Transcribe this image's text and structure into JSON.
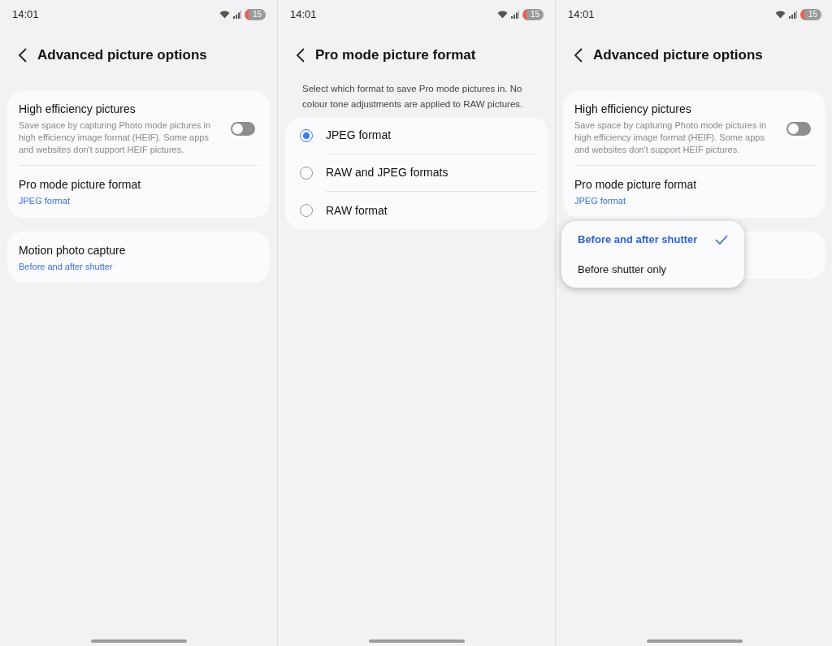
{
  "screens": [
    {
      "status": {
        "time": "14:01",
        "battery": "15"
      },
      "title": "Advanced picture options",
      "cards": [
        {
          "items": [
            {
              "kind": "toggle",
              "title": "High efficiency pictures",
              "description": "Save space by capturing Photo mode pictures in high efficiency image format (HEIF). Some apps and websites don't support HEIF pictures.",
              "on": false
            },
            {
              "kind": "value",
              "title": "Pro mode picture format",
              "value": "JPEG format"
            }
          ]
        },
        {
          "items": [
            {
              "kind": "value",
              "title": "Motion photo capture",
              "value": "Before and after shutter"
            }
          ]
        }
      ]
    },
    {
      "status": {
        "time": "14:01",
        "battery": "15"
      },
      "title": "Pro mode picture format",
      "description": "Select which format to save Pro mode pictures in. No colour tone adjustments are applied to RAW pictures.",
      "cards": [
        {
          "items": [
            {
              "kind": "radio",
              "title": "JPEG format",
              "selected": true
            },
            {
              "kind": "radio",
              "title": "RAW and JPEG formats",
              "selected": false
            },
            {
              "kind": "radio",
              "title": "RAW format",
              "selected": false
            }
          ]
        }
      ]
    },
    {
      "status": {
        "time": "14:01",
        "battery": "15"
      },
      "title": "Advanced picture options",
      "cards": [
        {
          "items": [
            {
              "kind": "toggle",
              "title": "High efficiency pictures",
              "description": "Save space by capturing Photo mode pictures in high efficiency image format (HEIF). Some apps and websites don't support HEIF pictures.",
              "on": false
            },
            {
              "kind": "value",
              "title": "Pro mode picture format",
              "value": "JPEG format"
            }
          ]
        },
        {
          "covered": true
        }
      ],
      "popup": {
        "options": [
          {
            "label": "Before and after shutter",
            "selected": true
          },
          {
            "label": "Before shutter only",
            "selected": false
          }
        ]
      }
    }
  ]
}
